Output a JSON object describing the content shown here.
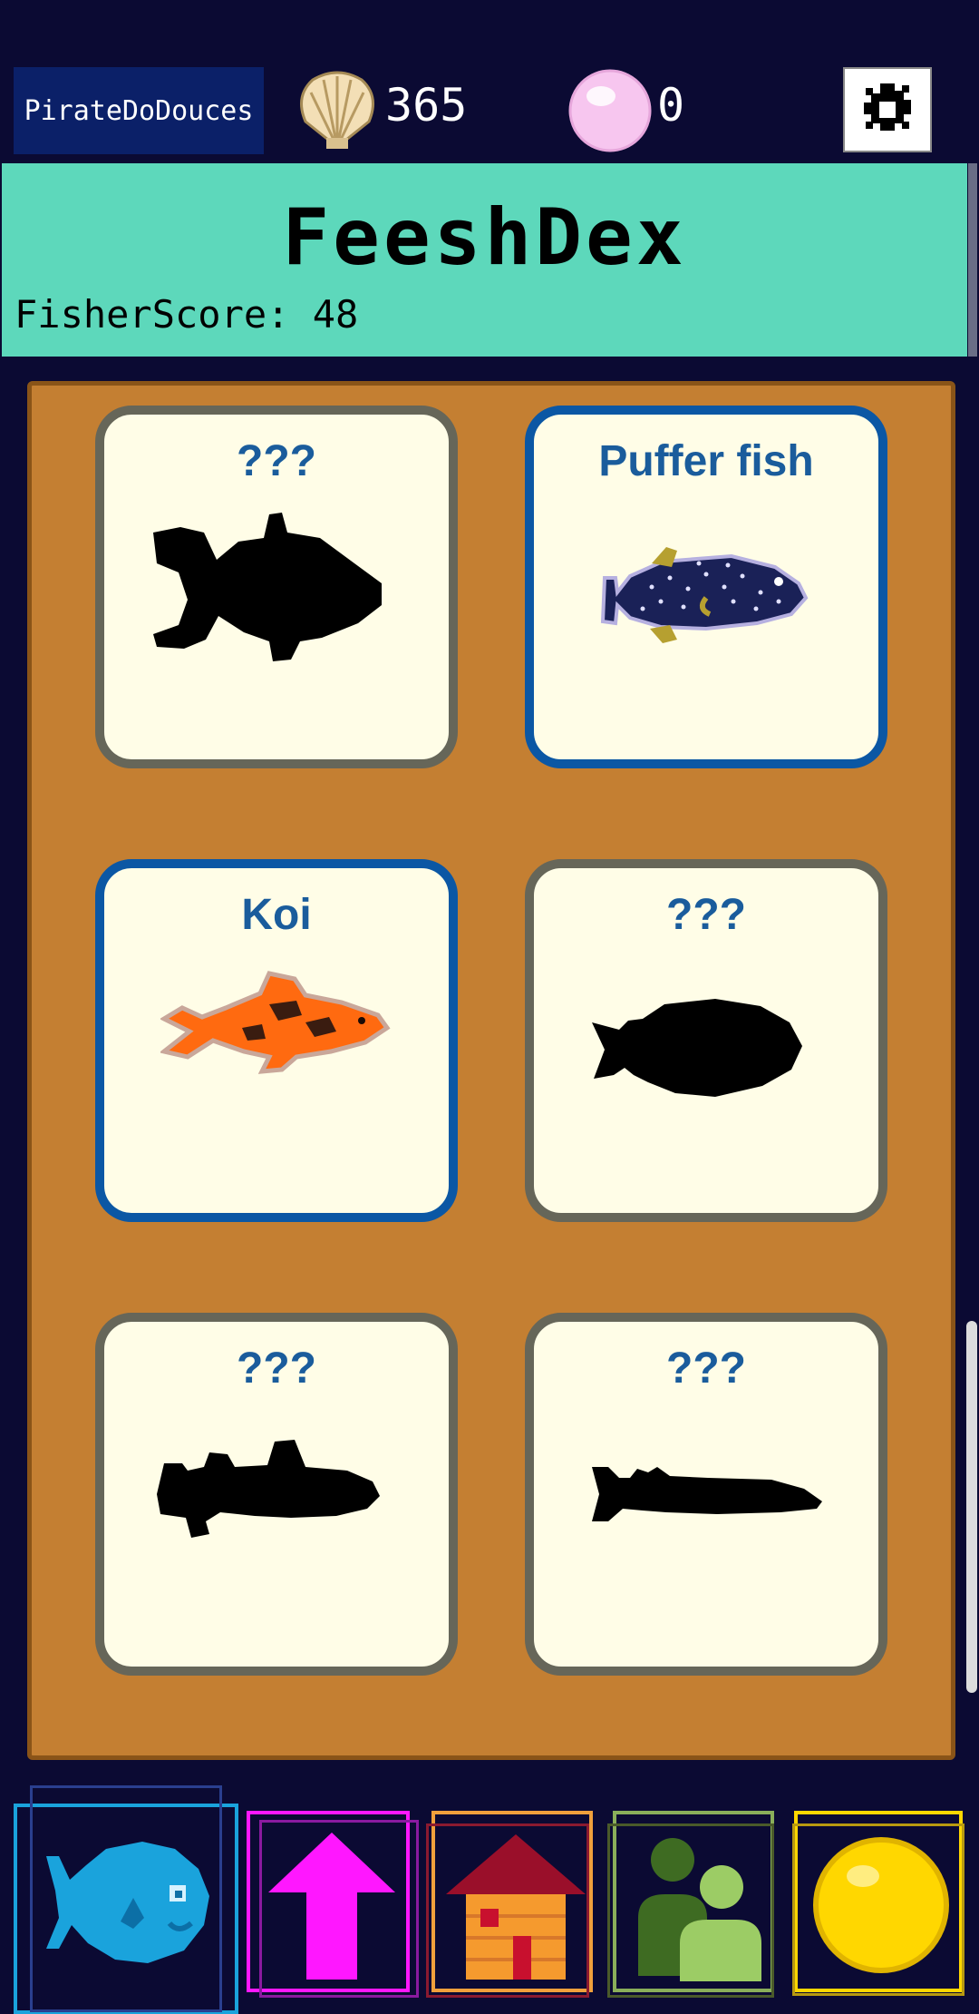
{
  "topbar": {
    "player_name": "PirateDoDouces",
    "shells": "365",
    "pearls": "0",
    "icons": {
      "shell": "scallop-shell-icon",
      "pearl": "pearl-icon",
      "settings": "gear-icon"
    }
  },
  "header": {
    "title": "FeeshDex",
    "score": "FisherScore: 48"
  },
  "cards": [
    {
      "name": "???",
      "caught": false
    },
    {
      "name": "Puffer fish",
      "caught": true
    },
    {
      "name": "Koi",
      "caught": true
    },
    {
      "name": "???",
      "caught": false
    },
    {
      "name": "???",
      "caught": false
    },
    {
      "name": "???",
      "caught": false
    }
  ],
  "nav": {
    "items": [
      {
        "icon": "fish-icon",
        "color": "#1aa3dc",
        "active": true
      },
      {
        "icon": "upgrade-arrow-icon",
        "color": "#ff17ff"
      },
      {
        "icon": "house-icon",
        "color": "#f0a03c"
      },
      {
        "icon": "people-icon",
        "color": "#8aae5a"
      },
      {
        "icon": "coin-icon",
        "color": "#ffd700"
      }
    ]
  },
  "colors": {
    "background": "#0b0a33",
    "header_bg": "#5dd8bb",
    "board_bg": "#c47f32",
    "card_bg": "#fffde7",
    "caught_border": "#0b57a4",
    "unknown_border": "#666659",
    "name_text": "#1a5c9c"
  }
}
